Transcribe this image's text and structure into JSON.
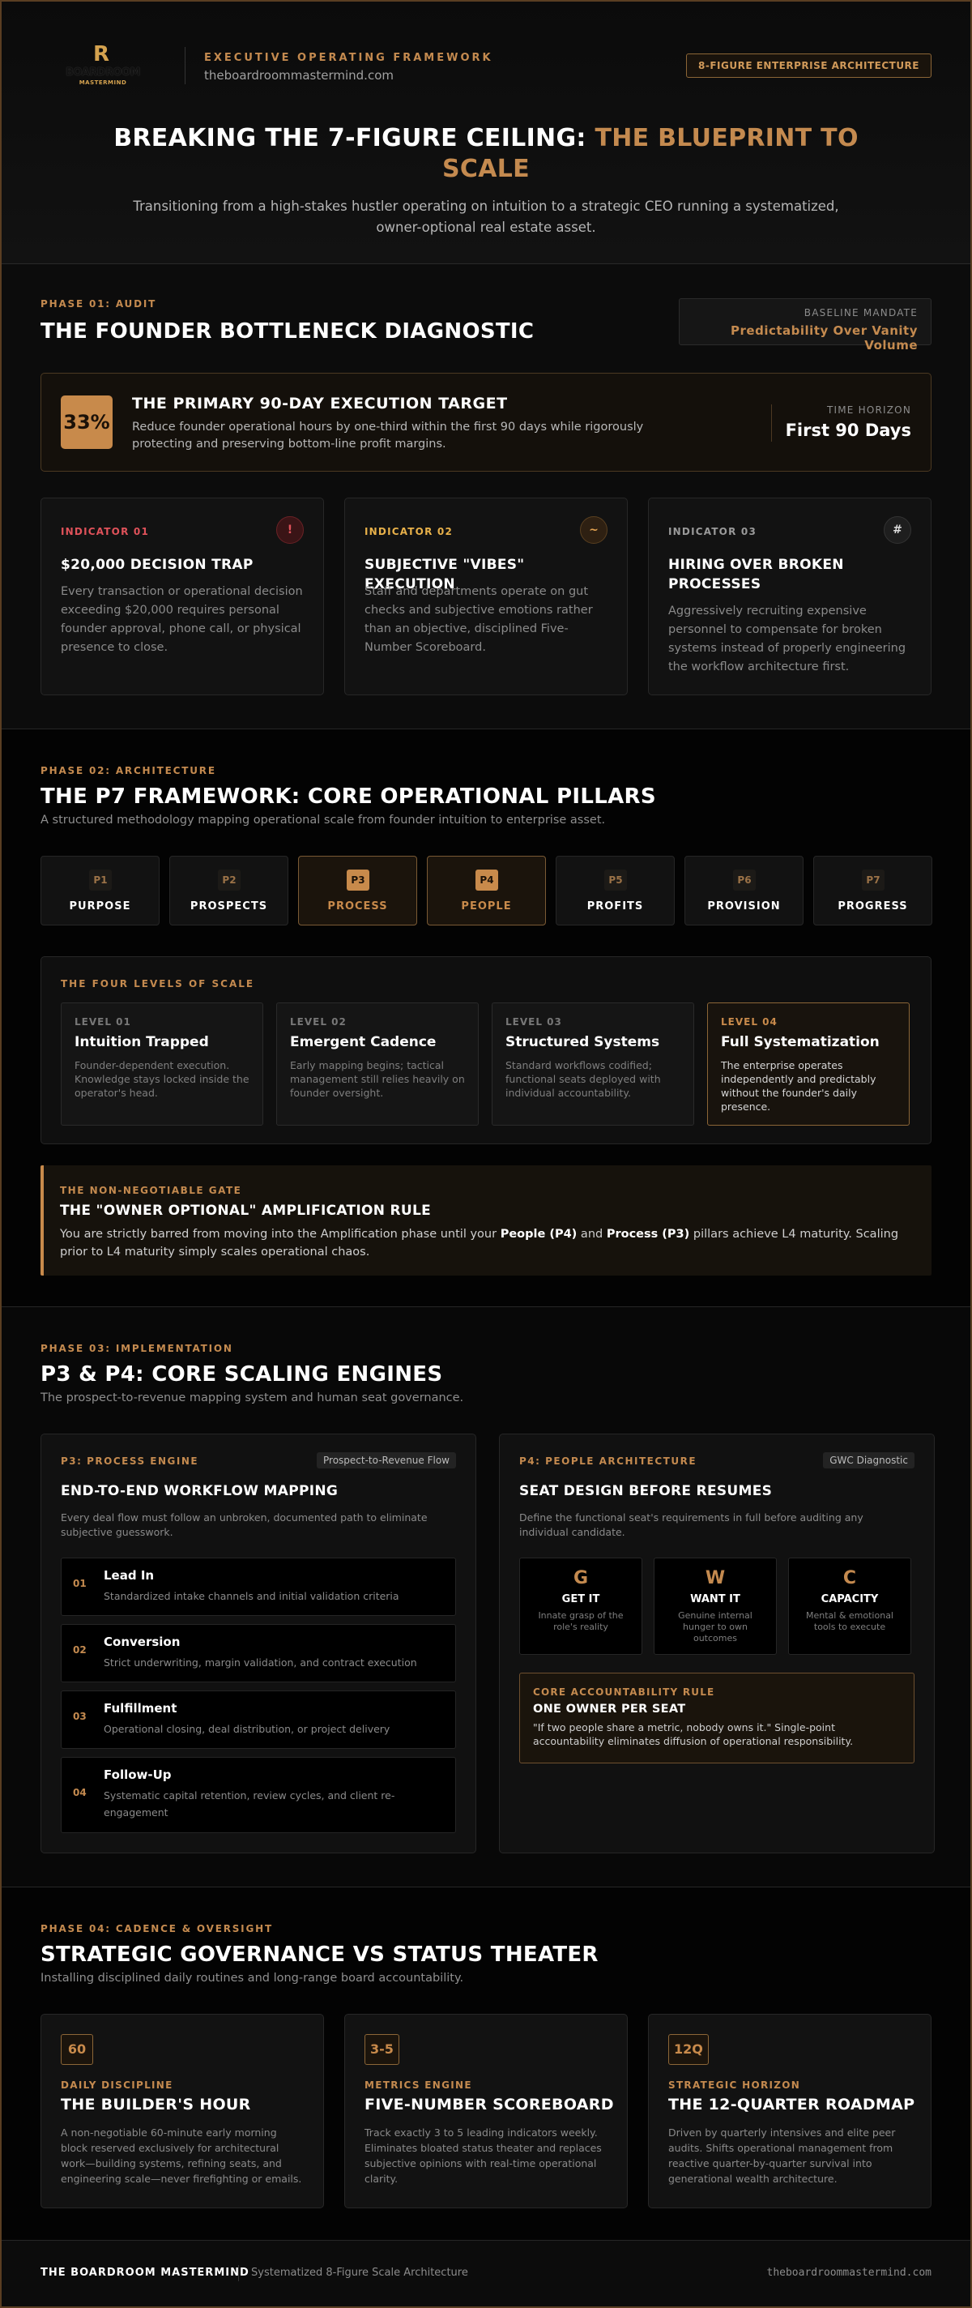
{
  "header": {
    "logo_text": "BOARDROOM",
    "logo_subtext": "MASTERMIND",
    "brand_tag": "EXECUTIVE OPERATING FRAMEWORK",
    "brand_url": "theboardroommastermind.com",
    "badge": "8-FIGURE ENTERPRISE ARCHITECTURE",
    "title_main": "BREAKING THE 7-FIGURE CEILING: ",
    "title_accent": "THE BLUEPRINT TO SCALE",
    "subtitle": "Transitioning from a high-stakes hustler operating on intuition to a strategic CEO running a systematized, owner-optional real estate asset."
  },
  "phase1": {
    "label": "PHASE 01: AUDIT",
    "title": "THE FOUNDER BOTTLENECK DIAGNOSTIC",
    "mandate_label": "BASELINE MANDATE",
    "mandate_value": "Predictability Over Vanity Volume",
    "target": {
      "percent": "33%",
      "title": "THE PRIMARY 90-DAY EXECUTION TARGET",
      "desc": "Reduce founder operational hours by one-third within the first 90 days while rigorously protecting and preserving bottom-line profit margins.",
      "horizon_label": "TIME HORIZON",
      "horizon_value": "First 90 Days"
    },
    "indicators": [
      {
        "tag": "INDICATOR 01",
        "icon": "!",
        "title": "$20,000 DECISION TRAP",
        "desc": "Every transaction or operational decision exceeding $20,000 requires personal founder approval, phone call, or physical presence to close."
      },
      {
        "tag": "INDICATOR 02",
        "icon": "~",
        "title": "SUBJECTIVE \"VIBES\" EXECUTION",
        "desc": "Staff and departments operate on gut checks and subjective emotions rather than an objective, disciplined Five-Number Scoreboard."
      },
      {
        "tag": "INDICATOR 03",
        "icon": "#",
        "title": "HIRING OVER BROKEN PROCESSES",
        "desc": "Aggressively recruiting expensive personnel to compensate for broken systems instead of properly engineering the workflow architecture first."
      }
    ],
    "colors": {
      "indicator_red": "#e0525a",
      "indicator_yellow": "#e8b14a",
      "indicator_grey": "#9a9a9a"
    }
  },
  "phase2": {
    "label": "PHASE 02: ARCHITECTURE",
    "title": "THE P7 FRAMEWORK: CORE OPERATIONAL PILLARS",
    "subtitle": "A structured methodology mapping operational scale from founder intuition to enterprise asset.",
    "pillars": [
      {
        "num": "P1",
        "name": "PURPOSE"
      },
      {
        "num": "P2",
        "name": "PROSPECTS"
      },
      {
        "num": "P3",
        "name": "PROCESS"
      },
      {
        "num": "P4",
        "name": "PEOPLE"
      },
      {
        "num": "P5",
        "name": "PROFITS"
      },
      {
        "num": "P6",
        "name": "PROVISION"
      },
      {
        "num": "P7",
        "name": "PROGRESS"
      }
    ],
    "levels_label": "THE FOUR LEVELS OF SCALE",
    "levels": [
      {
        "tag": "LEVEL 01",
        "title": "Intuition Trapped",
        "desc": "Founder-dependent execution. Knowledge stays locked inside the operator's head."
      },
      {
        "tag": "LEVEL 02",
        "title": "Emergent Cadence",
        "desc": "Early mapping begins; tactical management still relies heavily on founder oversight."
      },
      {
        "tag": "LEVEL 03",
        "title": "Structured Systems",
        "desc": "Standard workflows codified; functional seats deployed with individual accountability."
      },
      {
        "tag": "LEVEL 04",
        "title": "Full Systematization",
        "desc": "The enterprise operates independently and predictably without the founder's daily presence."
      }
    ],
    "gate": {
      "label": "THE NON-NEGOTIABLE GATE",
      "title": "THE \"OWNER OPTIONAL\" AMPLIFICATION RULE",
      "text_1": "You are strictly barred from moving into the Amplification phase until your ",
      "bold_1": "People (P4)",
      "text_2": " and ",
      "bold_2": "Process (P3)",
      "text_3": " pillars achieve L4 maturity. Scaling prior to L4 maturity simply scales operational chaos."
    }
  },
  "phase3": {
    "label": "PHASE 03: IMPLEMENTATION",
    "title": "P3 & P4: CORE SCALING ENGINES",
    "subtitle": "The prospect-to-revenue mapping system and human seat governance.",
    "process": {
      "label": "P3: PROCESS ENGINE",
      "pill": "Prospect-to-Revenue Flow",
      "title": "END-TO-END WORKFLOW MAPPING",
      "desc": "Every deal flow must follow an unbroken, documented path to eliminate subjective guesswork.",
      "steps": [
        {
          "num": "01",
          "title": "Lead In",
          "desc": "Standardized intake channels and initial validation criteria"
        },
        {
          "num": "02",
          "title": "Conversion",
          "desc": "Strict underwriting, margin validation, and contract execution"
        },
        {
          "num": "03",
          "title": "Fulfillment",
          "desc": "Operational closing, deal distribution, or project delivery"
        },
        {
          "num": "04",
          "title": "Follow-Up",
          "desc": "Systematic capital retention, review cycles, and client re-engagement"
        }
      ]
    },
    "people": {
      "label": "P4: PEOPLE ARCHITECTURE",
      "pill": "GWC Diagnostic",
      "title": "SEAT DESIGN BEFORE RESUMES",
      "desc": "Define the functional seat's requirements in full before auditing any individual candidate.",
      "gwc": [
        {
          "letter": "G",
          "title": "GET IT",
          "desc": "Innate grasp of the role's reality"
        },
        {
          "letter": "W",
          "title": "WANT IT",
          "desc": "Genuine internal hunger to own outcomes"
        },
        {
          "letter": "C",
          "title": "CAPACITY",
          "desc": "Mental & emotional tools to execute"
        }
      ],
      "rule_label": "CORE ACCOUNTABILITY RULE",
      "rule_title": "ONE OWNER PER SEAT",
      "rule_desc": "\"If two people share a metric, nobody owns it.\" Single-point accountability eliminates diffusion of operational responsibility."
    }
  },
  "phase4": {
    "label": "PHASE 04: CADENCE & OVERSIGHT",
    "title": "STRATEGIC GOVERNANCE VS STATUS THEATER",
    "subtitle": "Installing disciplined daily routines and long-range board accountability.",
    "cards": [
      {
        "badge": "60",
        "label": "DAILY DISCIPLINE",
        "title": "THE BUILDER'S HOUR",
        "desc": "A non-negotiable 60-minute early morning block reserved exclusively for architectural work—building systems, refining seats, and engineering scale—never firefighting or emails."
      },
      {
        "badge": "3-5",
        "label": "METRICS ENGINE",
        "title": "FIVE-NUMBER SCOREBOARD",
        "desc": "Track exactly 3 to 5 leading indicators weekly. Eliminates bloated status theater and replaces subjective opinions with real-time operational clarity."
      },
      {
        "badge": "12Q",
        "label": "STRATEGIC HORIZON",
        "title": "THE 12-QUARTER ROADMAP",
        "desc": "Driven by quarterly intensives and elite peer audits. Shifts operational management from reactive quarter-by-quarter survival into generational wealth architecture."
      }
    ]
  },
  "footer": {
    "brand": "THE BOARDROOM MASTERMIND",
    "tag": "Systematized 8-Figure Scale Architecture",
    "url": "theboardroommastermind.com"
  }
}
